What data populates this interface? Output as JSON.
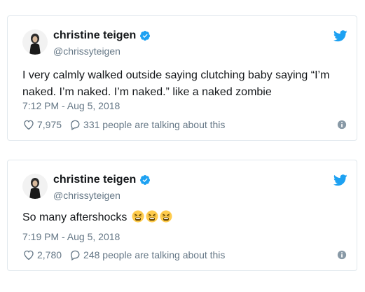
{
  "tweets": [
    {
      "author": {
        "name": "christine teigen",
        "handle": "@chrissyteigen",
        "verified_icon": "verified-badge-icon"
      },
      "text": "I very calmly walked outside saying clutching baby saying “I’m naked. I’m naked. I’m naked.” like a naked zombie",
      "timestamp": "7:12 PM - Aug 5, 2018",
      "likes": "7,975",
      "talking": "331 people are talking about this",
      "emojis": []
    },
    {
      "author": {
        "name": "christine teigen",
        "handle": "@chrissyteigen",
        "verified_icon": "verified-badge-icon"
      },
      "text": "So many aftershocks",
      "timestamp": "7:19 PM - Aug 5, 2018",
      "likes": "2,780",
      "talking": "248 people are talking about this",
      "emojis": [
        "tired-face",
        "tired-face",
        "tired-face"
      ]
    }
  ],
  "colors": {
    "twitter_blue": "#1da1f2",
    "text": "#14171a",
    "muted": "#657786",
    "border": "#e1e8ed",
    "emoji_yellow": "#ffcc4d"
  }
}
